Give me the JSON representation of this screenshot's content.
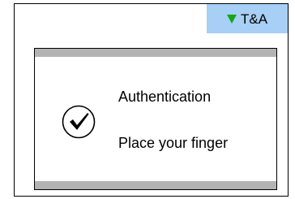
{
  "mode_badge": {
    "icon": "triangle-down-icon",
    "label": "T&A",
    "background": "#a8cff5",
    "icon_color": "#14a614"
  },
  "dialog": {
    "icon": "checkmark-circle-icon",
    "title": "Authentication",
    "message": "Place your finger",
    "bar_color": "#b3b3b3"
  }
}
